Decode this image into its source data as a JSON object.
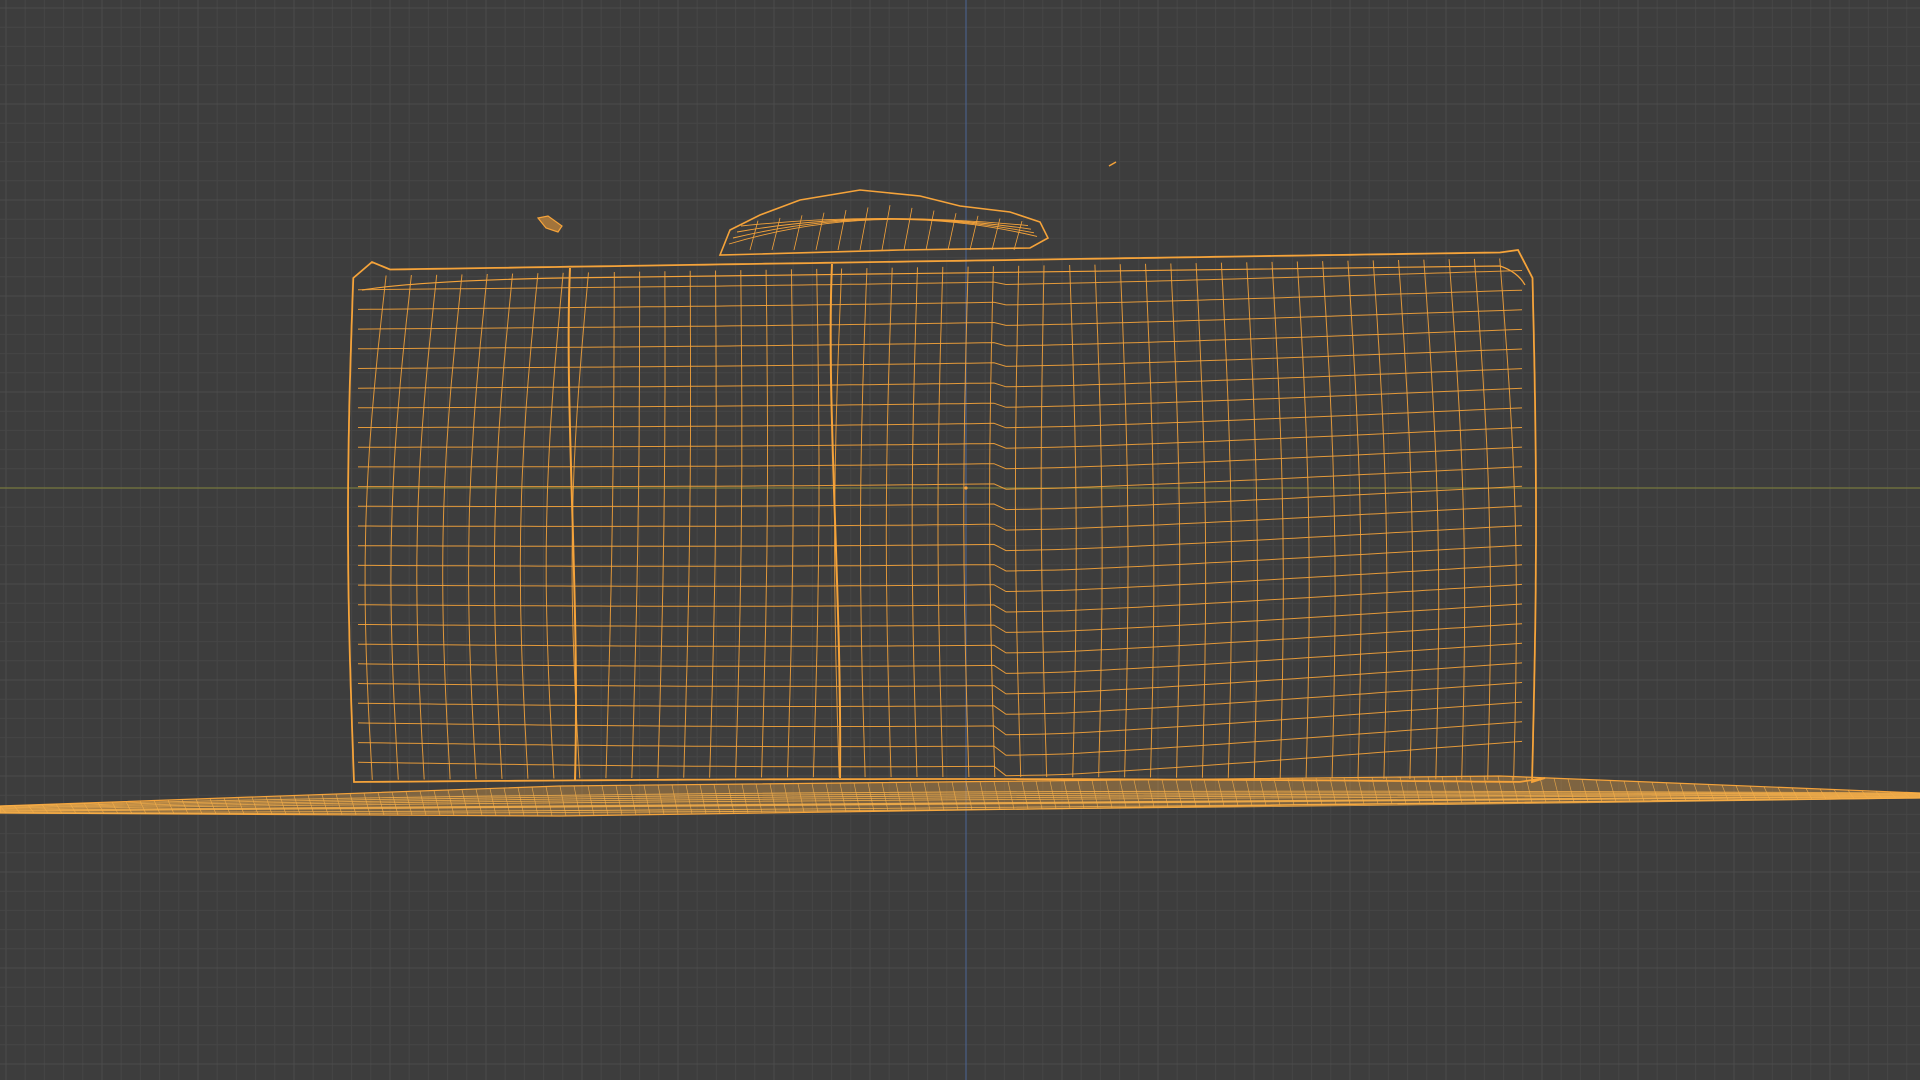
{
  "viewport": {
    "view": "orthographic-front",
    "shading": "wireframe",
    "object_selected": true,
    "colors": {
      "background": "#3d3d3d",
      "grid_minor": "#464646",
      "grid_major": "#4c4c4c",
      "axis_x": "#77783f",
      "axis_z": "#4a5f87",
      "wire_selected": "#f5a33a",
      "wire_dense": "#f8b04a",
      "origin_dot": "#f5a33a"
    },
    "objects": [
      {
        "name": "scanned-box-mesh",
        "type": "mesh",
        "selected": true
      },
      {
        "name": "ground-plane-mesh",
        "type": "mesh",
        "selected": true
      }
    ]
  }
}
